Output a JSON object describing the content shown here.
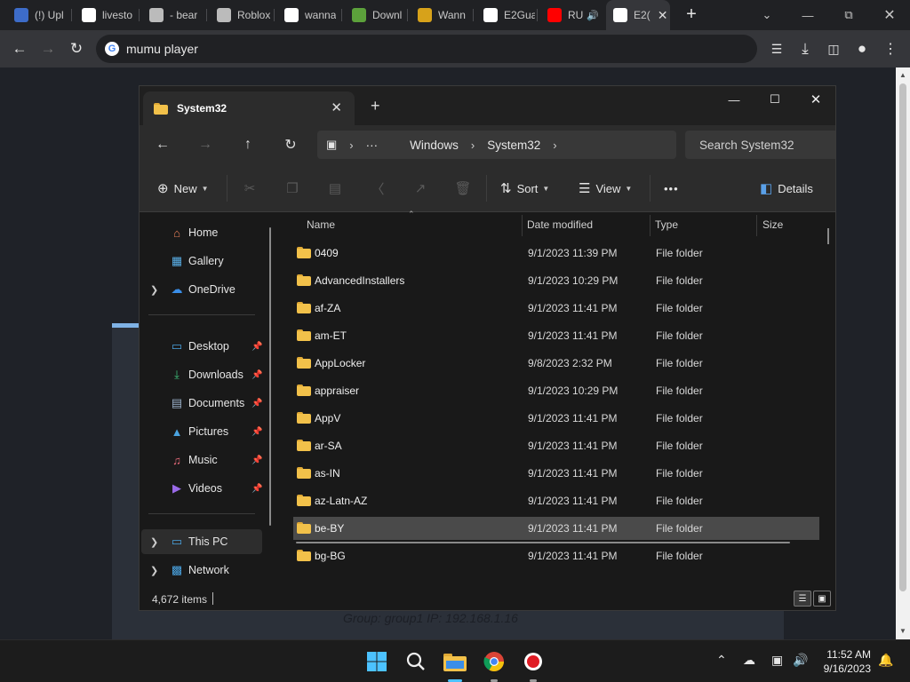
{
  "browser": {
    "tabs": [
      {
        "title": "(!) Upl",
        "favicon": "vl-logo-icon",
        "color": "#3d6cc9"
      },
      {
        "title": "livesto",
        "favicon": "google-icon",
        "color": "#ffffff"
      },
      {
        "title": "- bear",
        "favicon": "roblox-icon",
        "color": "#bbbbbb"
      },
      {
        "title": "Roblox",
        "favicon": "roblox-icon",
        "color": "#bbbbbb"
      },
      {
        "title": "wanna",
        "favicon": "github-icon",
        "color": "#ffffff"
      },
      {
        "title": "Downl",
        "favicon": "mod-site-icon",
        "color": "#5ca13b"
      },
      {
        "title": "Wann",
        "favicon": "number-site-icon",
        "color": "#d7a21a"
      },
      {
        "title": "E2Gua",
        "favicon": "github-icon",
        "color": "#ffffff"
      },
      {
        "title": "RU",
        "favicon": "youtube-icon",
        "color": "#ff0000"
      },
      {
        "title": "E2(",
        "favicon": "github-icon",
        "color": "#ffffff"
      }
    ],
    "active_tab_index": 9,
    "new_tab_label": "+",
    "omnibox_text": "mumu player"
  },
  "explorer": {
    "tab_title": "System32",
    "breadcrumb": [
      "Windows",
      "System32"
    ],
    "search_placeholder": "Search System32",
    "commands": {
      "new": "New",
      "sort": "Sort",
      "view": "View",
      "more": "•••",
      "details": "Details"
    },
    "nav": {
      "home": "Home",
      "gallery": "Gallery",
      "onedrive": "OneDrive",
      "desktop": "Desktop",
      "downloads": "Downloads",
      "documents": "Documents",
      "pictures": "Pictures",
      "music": "Music",
      "videos": "Videos",
      "thispc": "This PC",
      "network": "Network"
    },
    "columns": {
      "name": "Name",
      "date": "Date modified",
      "type": "Type",
      "size": "Size"
    },
    "files": [
      {
        "name": "0409",
        "date": "9/1/2023 11:39 PM",
        "type": "File folder"
      },
      {
        "name": "AdvancedInstallers",
        "date": "9/1/2023 10:29 PM",
        "type": "File folder"
      },
      {
        "name": "af-ZA",
        "date": "9/1/2023 11:41 PM",
        "type": "File folder"
      },
      {
        "name": "am-ET",
        "date": "9/1/2023 11:41 PM",
        "type": "File folder"
      },
      {
        "name": "AppLocker",
        "date": "9/8/2023 2:32 PM",
        "type": "File folder"
      },
      {
        "name": "appraiser",
        "date": "9/1/2023 10:29 PM",
        "type": "File folder"
      },
      {
        "name": "AppV",
        "date": "9/1/2023 11:41 PM",
        "type": "File folder"
      },
      {
        "name": "ar-SA",
        "date": "9/1/2023 11:41 PM",
        "type": "File folder"
      },
      {
        "name": "as-IN",
        "date": "9/1/2023 11:41 PM",
        "type": "File folder"
      },
      {
        "name": "az-Latn-AZ",
        "date": "9/1/2023 11:41 PM",
        "type": "File folder"
      },
      {
        "name": "be-BY",
        "date": "9/1/2023 11:41 PM",
        "type": "File folder"
      },
      {
        "name": "bg-BG",
        "date": "9/1/2023 11:41 PM",
        "type": "File folder"
      }
    ],
    "selected_row_index": 10,
    "status_count": "4,672 items"
  },
  "background_page": {
    "group_line": "Group: group1   IP: 192.168.1.16"
  },
  "taskbar": {
    "time": "11:52 AM",
    "date": "9/16/2023"
  }
}
